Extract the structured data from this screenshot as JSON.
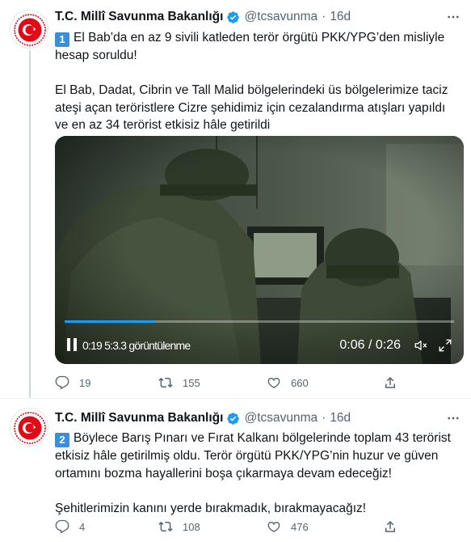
{
  "colors": {
    "accent": "#1d9bf0",
    "text": "#0f1419",
    "muted": "#536471",
    "avatar_red": "#e30a17",
    "keycap": "#3b8fd9"
  },
  "tweets": [
    {
      "author_name": "T.C. Millî Savunma Bakanlığı",
      "handle": "@tcsavunma",
      "separator": "·",
      "time": "16d",
      "number_emoji": "1",
      "lines": [
        "El Bab’da en az 9 sivili katleden terör örgütü PKK/YPG’den misliyle hesap soruldu!",
        "El Bab, Dadat, Cibrin ve Tall Malid bölgelerindeki üs bölgelerimize taciz ateşi açan teröristlere Cizre şehidimiz için cezalandırma atışları yapıldı ve en az 34 terörist etkisiz hâle getirildi"
      ],
      "video": {
        "views_text": "0:19 5:3.3 görüntülenme",
        "duration_text": "0:06 / 0:26",
        "progress": 0.23
      },
      "replies": "19",
      "retweets": "155",
      "likes": "660"
    },
    {
      "author_name": "T.C. Millî Savunma Bakanlığı",
      "handle": "@tcsavunma",
      "separator": "·",
      "time": "16d",
      "number_emoji": "2",
      "lines": [
        "Böylece Barış Pınarı ve Fırat Kalkanı bölgelerinde toplam 43 terörist etkisiz hâle getirilmiş oldu. Terör örgütü PKK/YPG’nin huzur ve güven ortamını bozma hayallerini boşa çıkarmaya devam edeceğiz!",
        "Şehitlerimizin kanını yerde bırakmadık, bırakmayacağız!"
      ],
      "replies": "4",
      "retweets": "108",
      "likes": "476"
    }
  ]
}
